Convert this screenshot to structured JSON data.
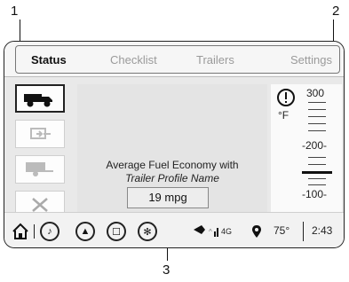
{
  "callouts": [
    "1",
    "2",
    "3"
  ],
  "tabs": [
    "Status",
    "Checklist",
    "Trailers",
    "Settings"
  ],
  "sidebar": {
    "items": [
      {
        "icon": "truck-icon",
        "active": true
      },
      {
        "icon": "trailer-connect-icon",
        "active": false
      },
      {
        "icon": "trailer-icon",
        "active": false
      },
      {
        "icon": "tools-icon",
        "active": false
      }
    ]
  },
  "center": {
    "title": "Average Fuel Economy with",
    "subtitle": "Trailer Profile Name",
    "value": "19 mpg"
  },
  "gauge": {
    "unit": "°F",
    "labels": [
      "300",
      "-200-",
      "-100-"
    ],
    "icon": "engine-warning-icon"
  },
  "bottombar": {
    "temp": "75°",
    "time": "2:43",
    "network": "4G",
    "icons": [
      "home-icon",
      "music-icon",
      "navigation-icon",
      "phone-icon",
      "onstar-icon",
      "signal-icon",
      "location-icon"
    ]
  },
  "colors": {
    "frame": "#e9e9e9",
    "tabbar": "#f6f6f6",
    "active_text": "#111111",
    "inactive_text": "#9a9a9a"
  }
}
